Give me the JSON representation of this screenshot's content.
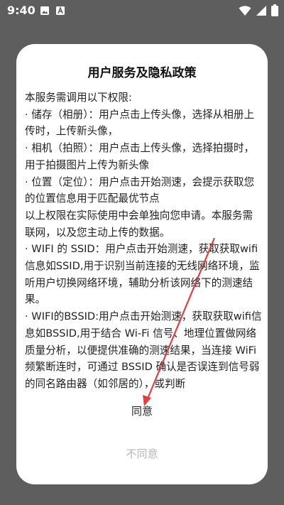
{
  "status_bar": {
    "time": "9:40",
    "left_icons": [
      "image-icon",
      "font-a-icon"
    ],
    "right_icons": [
      "wifi-icon",
      "signal-icon",
      "battery-icon"
    ]
  },
  "dialog": {
    "title": "用户服务及隐私政策",
    "paragraphs": [
      "本服务需调用以下权限:",
      "· 储存（相册）：用户点击上传头像，选择从相册上传时，上传新头像，",
      "· 相机（拍照）：用户点击上传头像，选择拍摄时，用于拍摄图片上传为新头像",
      "· 位置（定位）：用户点击开始测速，会提示获取您的位置信息用于匹配最优节点",
      "以上权限在实际使用中会单独向您申请。本服务需联网，以及您主动上传的数据。",
      "· WIFI 的 SSID：用户点击开始测速，获取获取wifi信息如SSID,用于识别当前连接的无线网络环境，监听用户切换网络环境，辅助分析该网络下的测速结果。",
      "· WIFI的BSSID:用户点击开始测速，获取获取wifi信息如BSSID,用于结合 Wi-Fi 信号、地理位置做网络质量分析，以便提供准确的测速结果，当连接 WiFi 频繁断连时，可通过 BSSID 确认是否误连到信号弱的同名路由器（如邻居的），或判断"
    ],
    "agree_label": "同意",
    "disagree_label": "不同意"
  },
  "annotation": {
    "color": "#e04040"
  }
}
